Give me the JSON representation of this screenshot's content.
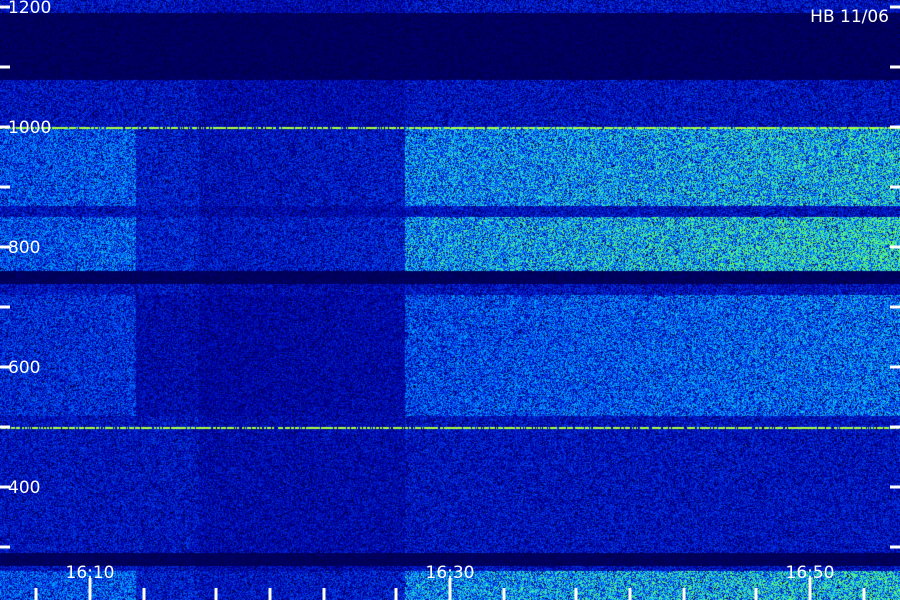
{
  "chart_data": {
    "type": "heatmap",
    "title": "",
    "station_label": "HB 11/06",
    "xlabel": "",
    "ylabel": "",
    "x_range": [
      "16:05",
      "16:55"
    ],
    "x_tick_labels": [
      "16:10",
      "16:30",
      "16:50"
    ],
    "x_tick_minutes_labeled": [
      10,
      30,
      50
    ],
    "x_tick_minutes_minor": [
      7,
      13,
      17,
      20,
      23,
      27,
      33,
      37,
      40,
      43,
      47,
      53,
      57
    ],
    "y_range": [
      200,
      1200
    ],
    "y_tick_labels": [
      "1200",
      "1000",
      "800",
      "600",
      "400"
    ],
    "y_tick_values": [
      1200,
      1000,
      800,
      600,
      400
    ],
    "y_minor_tick_values": [
      1100,
      900,
      700,
      500,
      300
    ],
    "grid": false,
    "legend": "none",
    "colormap": [
      "#000033",
      "#0000aa",
      "#0044ee",
      "#0099ff",
      "#33ddcc",
      "#66ff66"
    ],
    "spectral_lines": [
      {
        "frequency": 1000,
        "color": "#aaff44"
      },
      {
        "frequency": 500,
        "color": "#aaff44"
      }
    ],
    "emission_bands": [
      {
        "f_low": 870,
        "f_high": 1000,
        "level_start": 0.45,
        "level_end": 0.75
      },
      {
        "f_low": 760,
        "f_high": 850,
        "level_start": 0.45,
        "level_end": 0.85
      },
      {
        "f_low": 520,
        "f_high": 720,
        "level_start": 0.35,
        "level_end": 0.55
      },
      {
        "f_low": 200,
        "f_high": 260,
        "level_start": 0.45,
        "level_end": 0.8
      }
    ],
    "dark_bands": [
      {
        "f_low": 1080,
        "f_high": 1190
      },
      {
        "f_low": 740,
        "f_high": 760
      },
      {
        "f_low": 270,
        "f_high": 290
      }
    ]
  }
}
